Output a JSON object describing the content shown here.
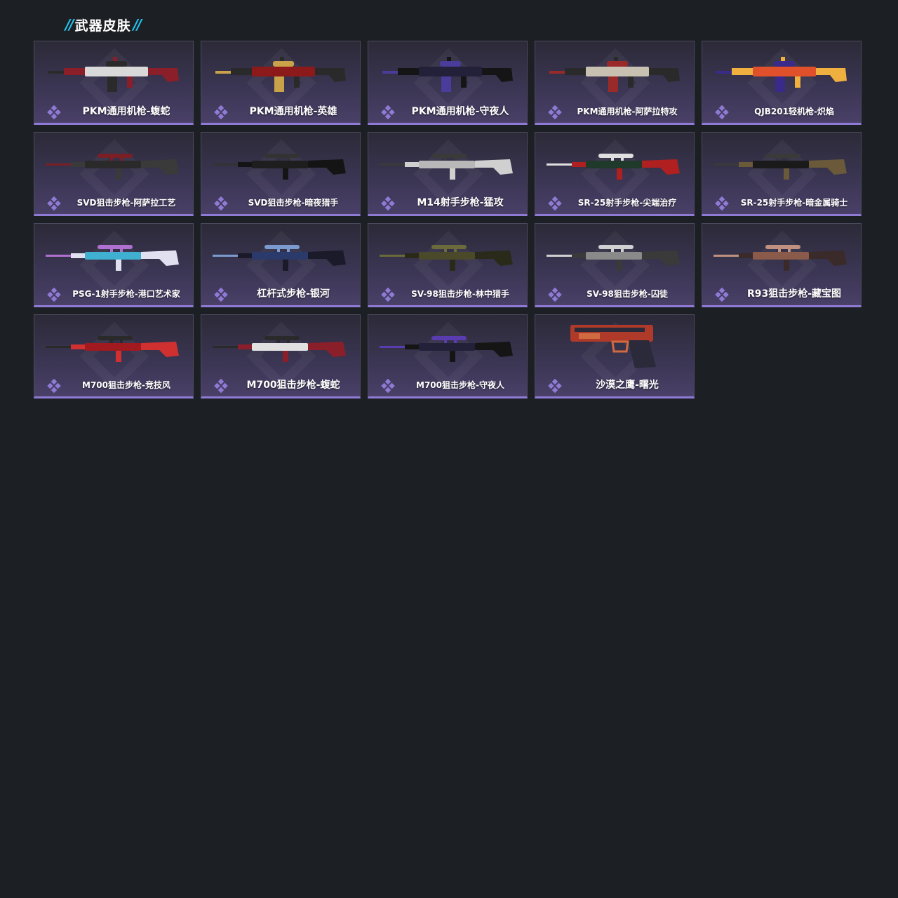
{
  "section": {
    "title": "武器皮肤",
    "accent_color": "#22c4ef"
  },
  "theme": {
    "card_top": "#2c2a38",
    "card_bottom": "#4a4068",
    "rarity_color": "#8f7ad6"
  },
  "skins": [
    {
      "name": "PKM通用机枪-蝮蛇",
      "weapon_icon": "machine-gun-icon",
      "colors": [
        "#d9d9d9",
        "#2a2a2a",
        "#8a1f2a"
      ]
    },
    {
      "name": "PKM通用机枪-英雄",
      "weapon_icon": "machine-gun-icon",
      "colors": [
        "#8c1a1a",
        "#c9a24a",
        "#2a2a2a"
      ]
    },
    {
      "name": "PKM通用机枪-守夜人",
      "weapon_icon": "machine-gun-icon",
      "colors": [
        "#23203a",
        "#4a3c9a",
        "#151515"
      ]
    },
    {
      "name": "PKM通用机枪-阿萨拉特攻",
      "weapon_icon": "machine-gun-icon",
      "colors": [
        "#c8c0b0",
        "#9a2a2a",
        "#2a2a2a"
      ]
    },
    {
      "name": "QJB201轻机枪-炽焰",
      "weapon_icon": "light-machine-gun-icon",
      "colors": [
        "#e0502a",
        "#3a2a8a",
        "#f0b040"
      ]
    },
    {
      "name": "SVD狙击步枪-阿萨拉工艺",
      "weapon_icon": "sniper-rifle-icon",
      "colors": [
        "#2a2a2a",
        "#7a1f25",
        "#3a3a3a"
      ]
    },
    {
      "name": "SVD狙击步枪-暗夜猎手",
      "weapon_icon": "sniper-rifle-icon",
      "colors": [
        "#1e1e1e",
        "#333333",
        "#141414"
      ]
    },
    {
      "name": "M14射手步枪-猛攻",
      "weapon_icon": "marksman-rifle-icon",
      "colors": [
        "#b8b8b8",
        "#3a3a3a",
        "#d0d0d0"
      ]
    },
    {
      "name": "SR-25射手步枪-尖端治疗",
      "weapon_icon": "marksman-rifle-icon",
      "colors": [
        "#1f3a2a",
        "#e0e0e0",
        "#b02020"
      ]
    },
    {
      "name": "SR-25射手步枪-暗金属骑士",
      "weapon_icon": "marksman-rifle-icon",
      "colors": [
        "#1a1a1a",
        "#3a3a3a",
        "#6a5a3a"
      ]
    },
    {
      "name": "PSG-1射手步枪-港口艺术家",
      "weapon_icon": "marksman-rifle-icon",
      "colors": [
        "#40b0d0",
        "#b070d0",
        "#e0e0f0"
      ]
    },
    {
      "name": "杠杆式步枪-银河",
      "weapon_icon": "lever-action-rifle-icon",
      "colors": [
        "#2a3a6a",
        "#7a9ad0",
        "#1a1a2a"
      ]
    },
    {
      "name": "SV-98狙击步枪-林中猎手",
      "weapon_icon": "sniper-rifle-icon",
      "colors": [
        "#4a4a2a",
        "#6a6a3a",
        "#2a2a1a"
      ]
    },
    {
      "name": "SV-98狙击步枪-囚徒",
      "weapon_icon": "sniper-rifle-icon",
      "colors": [
        "#8a8a8a",
        "#d0d0d0",
        "#3a3a3a"
      ]
    },
    {
      "name": "R93狙击步枪-藏宝图",
      "weapon_icon": "sniper-rifle-icon",
      "colors": [
        "#8a5a4a",
        "#c09080",
        "#3a2a2a"
      ]
    },
    {
      "name": "M700狙击步枪-竞技风",
      "weapon_icon": "sniper-rifle-icon",
      "colors": [
        "#a01a20",
        "#2a2a2a",
        "#d03030"
      ]
    },
    {
      "name": "M700狙击步枪-蝮蛇",
      "weapon_icon": "sniper-rifle-icon",
      "colors": [
        "#e0e0e0",
        "#2a2a2a",
        "#8a1f2a"
      ]
    },
    {
      "name": "M700狙击步枪-守夜人",
      "weapon_icon": "sniper-rifle-icon",
      "colors": [
        "#23203a",
        "#5a3cb0",
        "#151515"
      ]
    },
    {
      "name": "沙漠之鹰-曙光",
      "weapon_icon": "pistol-icon",
      "colors": [
        "#b03a2a",
        "#2a2a3a",
        "#d06a40"
      ]
    }
  ]
}
